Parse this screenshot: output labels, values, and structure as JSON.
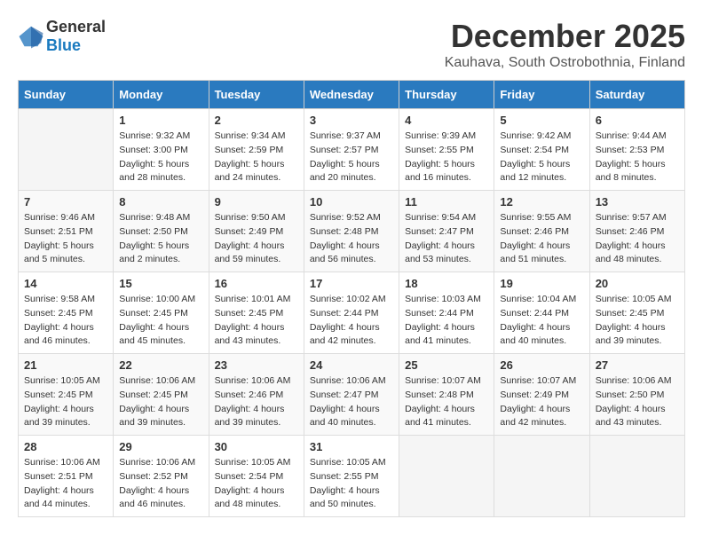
{
  "logo": {
    "general": "General",
    "blue": "Blue"
  },
  "header": {
    "month": "December 2025",
    "location": "Kauhava, South Ostrobothnia, Finland"
  },
  "weekdays": [
    "Sunday",
    "Monday",
    "Tuesday",
    "Wednesday",
    "Thursday",
    "Friday",
    "Saturday"
  ],
  "weeks": [
    [
      {
        "day": "",
        "info": ""
      },
      {
        "day": "1",
        "info": "Sunrise: 9:32 AM\nSunset: 3:00 PM\nDaylight: 5 hours\nand 28 minutes."
      },
      {
        "day": "2",
        "info": "Sunrise: 9:34 AM\nSunset: 2:59 PM\nDaylight: 5 hours\nand 24 minutes."
      },
      {
        "day": "3",
        "info": "Sunrise: 9:37 AM\nSunset: 2:57 PM\nDaylight: 5 hours\nand 20 minutes."
      },
      {
        "day": "4",
        "info": "Sunrise: 9:39 AM\nSunset: 2:55 PM\nDaylight: 5 hours\nand 16 minutes."
      },
      {
        "day": "5",
        "info": "Sunrise: 9:42 AM\nSunset: 2:54 PM\nDaylight: 5 hours\nand 12 minutes."
      },
      {
        "day": "6",
        "info": "Sunrise: 9:44 AM\nSunset: 2:53 PM\nDaylight: 5 hours\nand 8 minutes."
      }
    ],
    [
      {
        "day": "7",
        "info": "Sunrise: 9:46 AM\nSunset: 2:51 PM\nDaylight: 5 hours\nand 5 minutes."
      },
      {
        "day": "8",
        "info": "Sunrise: 9:48 AM\nSunset: 2:50 PM\nDaylight: 5 hours\nand 2 minutes."
      },
      {
        "day": "9",
        "info": "Sunrise: 9:50 AM\nSunset: 2:49 PM\nDaylight: 4 hours\nand 59 minutes."
      },
      {
        "day": "10",
        "info": "Sunrise: 9:52 AM\nSunset: 2:48 PM\nDaylight: 4 hours\nand 56 minutes."
      },
      {
        "day": "11",
        "info": "Sunrise: 9:54 AM\nSunset: 2:47 PM\nDaylight: 4 hours\nand 53 minutes."
      },
      {
        "day": "12",
        "info": "Sunrise: 9:55 AM\nSunset: 2:46 PM\nDaylight: 4 hours\nand 51 minutes."
      },
      {
        "day": "13",
        "info": "Sunrise: 9:57 AM\nSunset: 2:46 PM\nDaylight: 4 hours\nand 48 minutes."
      }
    ],
    [
      {
        "day": "14",
        "info": "Sunrise: 9:58 AM\nSunset: 2:45 PM\nDaylight: 4 hours\nand 46 minutes."
      },
      {
        "day": "15",
        "info": "Sunrise: 10:00 AM\nSunset: 2:45 PM\nDaylight: 4 hours\nand 45 minutes."
      },
      {
        "day": "16",
        "info": "Sunrise: 10:01 AM\nSunset: 2:45 PM\nDaylight: 4 hours\nand 43 minutes."
      },
      {
        "day": "17",
        "info": "Sunrise: 10:02 AM\nSunset: 2:44 PM\nDaylight: 4 hours\nand 42 minutes."
      },
      {
        "day": "18",
        "info": "Sunrise: 10:03 AM\nSunset: 2:44 PM\nDaylight: 4 hours\nand 41 minutes."
      },
      {
        "day": "19",
        "info": "Sunrise: 10:04 AM\nSunset: 2:44 PM\nDaylight: 4 hours\nand 40 minutes."
      },
      {
        "day": "20",
        "info": "Sunrise: 10:05 AM\nSunset: 2:45 PM\nDaylight: 4 hours\nand 39 minutes."
      }
    ],
    [
      {
        "day": "21",
        "info": "Sunrise: 10:05 AM\nSunset: 2:45 PM\nDaylight: 4 hours\nand 39 minutes."
      },
      {
        "day": "22",
        "info": "Sunrise: 10:06 AM\nSunset: 2:45 PM\nDaylight: 4 hours\nand 39 minutes."
      },
      {
        "day": "23",
        "info": "Sunrise: 10:06 AM\nSunset: 2:46 PM\nDaylight: 4 hours\nand 39 minutes."
      },
      {
        "day": "24",
        "info": "Sunrise: 10:06 AM\nSunset: 2:47 PM\nDaylight: 4 hours\nand 40 minutes."
      },
      {
        "day": "25",
        "info": "Sunrise: 10:07 AM\nSunset: 2:48 PM\nDaylight: 4 hours\nand 41 minutes."
      },
      {
        "day": "26",
        "info": "Sunrise: 10:07 AM\nSunset: 2:49 PM\nDaylight: 4 hours\nand 42 minutes."
      },
      {
        "day": "27",
        "info": "Sunrise: 10:06 AM\nSunset: 2:50 PM\nDaylight: 4 hours\nand 43 minutes."
      }
    ],
    [
      {
        "day": "28",
        "info": "Sunrise: 10:06 AM\nSunset: 2:51 PM\nDaylight: 4 hours\nand 44 minutes."
      },
      {
        "day": "29",
        "info": "Sunrise: 10:06 AM\nSunset: 2:52 PM\nDaylight: 4 hours\nand 46 minutes."
      },
      {
        "day": "30",
        "info": "Sunrise: 10:05 AM\nSunset: 2:54 PM\nDaylight: 4 hours\nand 48 minutes."
      },
      {
        "day": "31",
        "info": "Sunrise: 10:05 AM\nSunset: 2:55 PM\nDaylight: 4 hours\nand 50 minutes."
      },
      {
        "day": "",
        "info": ""
      },
      {
        "day": "",
        "info": ""
      },
      {
        "day": "",
        "info": ""
      }
    ]
  ]
}
